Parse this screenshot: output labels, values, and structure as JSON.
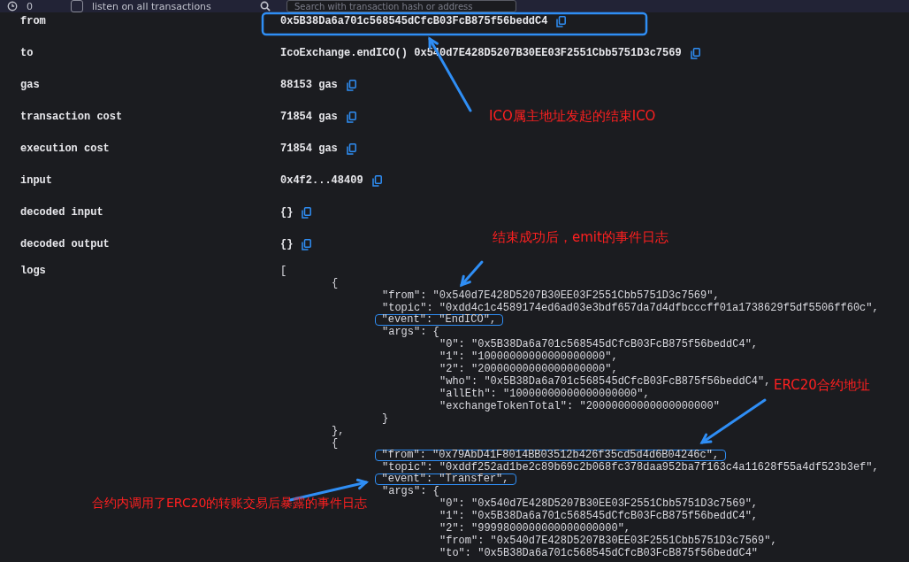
{
  "toolbar": {
    "count": "0",
    "listen": {
      "label": "listen on all transactions",
      "checked": false
    },
    "search": {
      "placeholder": "Search with transaction hash or address"
    }
  },
  "details": [
    {
      "label": "from",
      "value": "0x5B38Da6a701c568545dCfcB03FcB875f56beddC4"
    },
    {
      "label": "to",
      "value": "IcoExchange.endICO() 0x540d7E428D5207B30EE03F2551Cbb5751D3c7569"
    },
    {
      "label": "gas",
      "value": "88153 gas"
    },
    {
      "label": "transaction cost",
      "value": "71854 gas"
    },
    {
      "label": "execution cost",
      "value": "71854 gas"
    },
    {
      "label": "input",
      "value": "0x4f2...48409"
    },
    {
      "label": "decoded input",
      "value": "{}"
    },
    {
      "label": "decoded output",
      "value": "{}"
    }
  ],
  "logs": {
    "label": "logs",
    "lines": [
      {
        "text": "[",
        "children": [
          {
            "text": "{",
            "children": [
              {
                "text": "\"from\": \"0x540d7E428D5207B30EE03F2551Cbb5751D3c7569\","
              },
              {
                "text": "\"topic\": \"0xdd4c1c4589174ed6ad03e3bdf657da7d4dfbcccff01a1738629f5df5506ff60c\","
              },
              {
                "text": "\"event\": \"EndICO\",",
                "highlight": true
              },
              {
                "text": "\"args\": {",
                "children": [
                  {
                    "text": "\"0\": \"0x5B38Da6a701c568545dCfcB03FcB875f56beddC4\","
                  },
                  {
                    "text": "\"1\": \"10000000000000000000\","
                  },
                  {
                    "text": "\"2\": \"20000000000000000000\","
                  },
                  {
                    "text": "\"who\": \"0x5B38Da6a701c568545dCfcB03FcB875f56beddC4\","
                  },
                  {
                    "text": "\"allEth\": \"10000000000000000000\","
                  },
                  {
                    "text": "\"exchangeTokenTotal\": \"20000000000000000000\""
                  }
                ]
              },
              {
                "text": "}"
              }
            ]
          },
          {
            "text": "},"
          },
          {
            "text": "{",
            "children": [
              {
                "text": "\"from\": \"0x79AbD41F8014BB03512b426f35cd5d4d6B04246c\",",
                "highlight": true
              },
              {
                "text": "\"topic\": \"0xddf252ad1be2c89b69c2b068fc378daa952ba7f163c4a11628f55a4df523b3ef\","
              },
              {
                "text": "\"event\": \"Transfer\",",
                "highlight": true
              },
              {
                "text": "\"args\": {",
                "children": [
                  {
                    "text": "\"0\": \"0x540d7E428D5207B30EE03F2551Cbb5751D3c7569\","
                  },
                  {
                    "text": "\"1\": \"0x5B38Da6a701c568545dCfcB03FcB875f56beddC4\","
                  },
                  {
                    "text": "\"2\": \"9999800000000000000000\","
                  },
                  {
                    "text": "\"from\": \"0x540d7E428D5207B30EE03F2551Cbb5751D3c7569\","
                  },
                  {
                    "text": "\"to\": \"0x5B38Da6a701c568545dCfcB03FcB875f56beddC4\""
                  }
                ]
              }
            ]
          }
        ]
      }
    ]
  },
  "annotations": [
    {
      "text": "ICO属主地址发起的结束ICO"
    },
    {
      "text": "结束成功后，emit的事件日志"
    },
    {
      "text": "ERC20合约地址"
    },
    {
      "text": "合约内调用了ERC20的转账交易后暴露的事件日志"
    }
  ]
}
